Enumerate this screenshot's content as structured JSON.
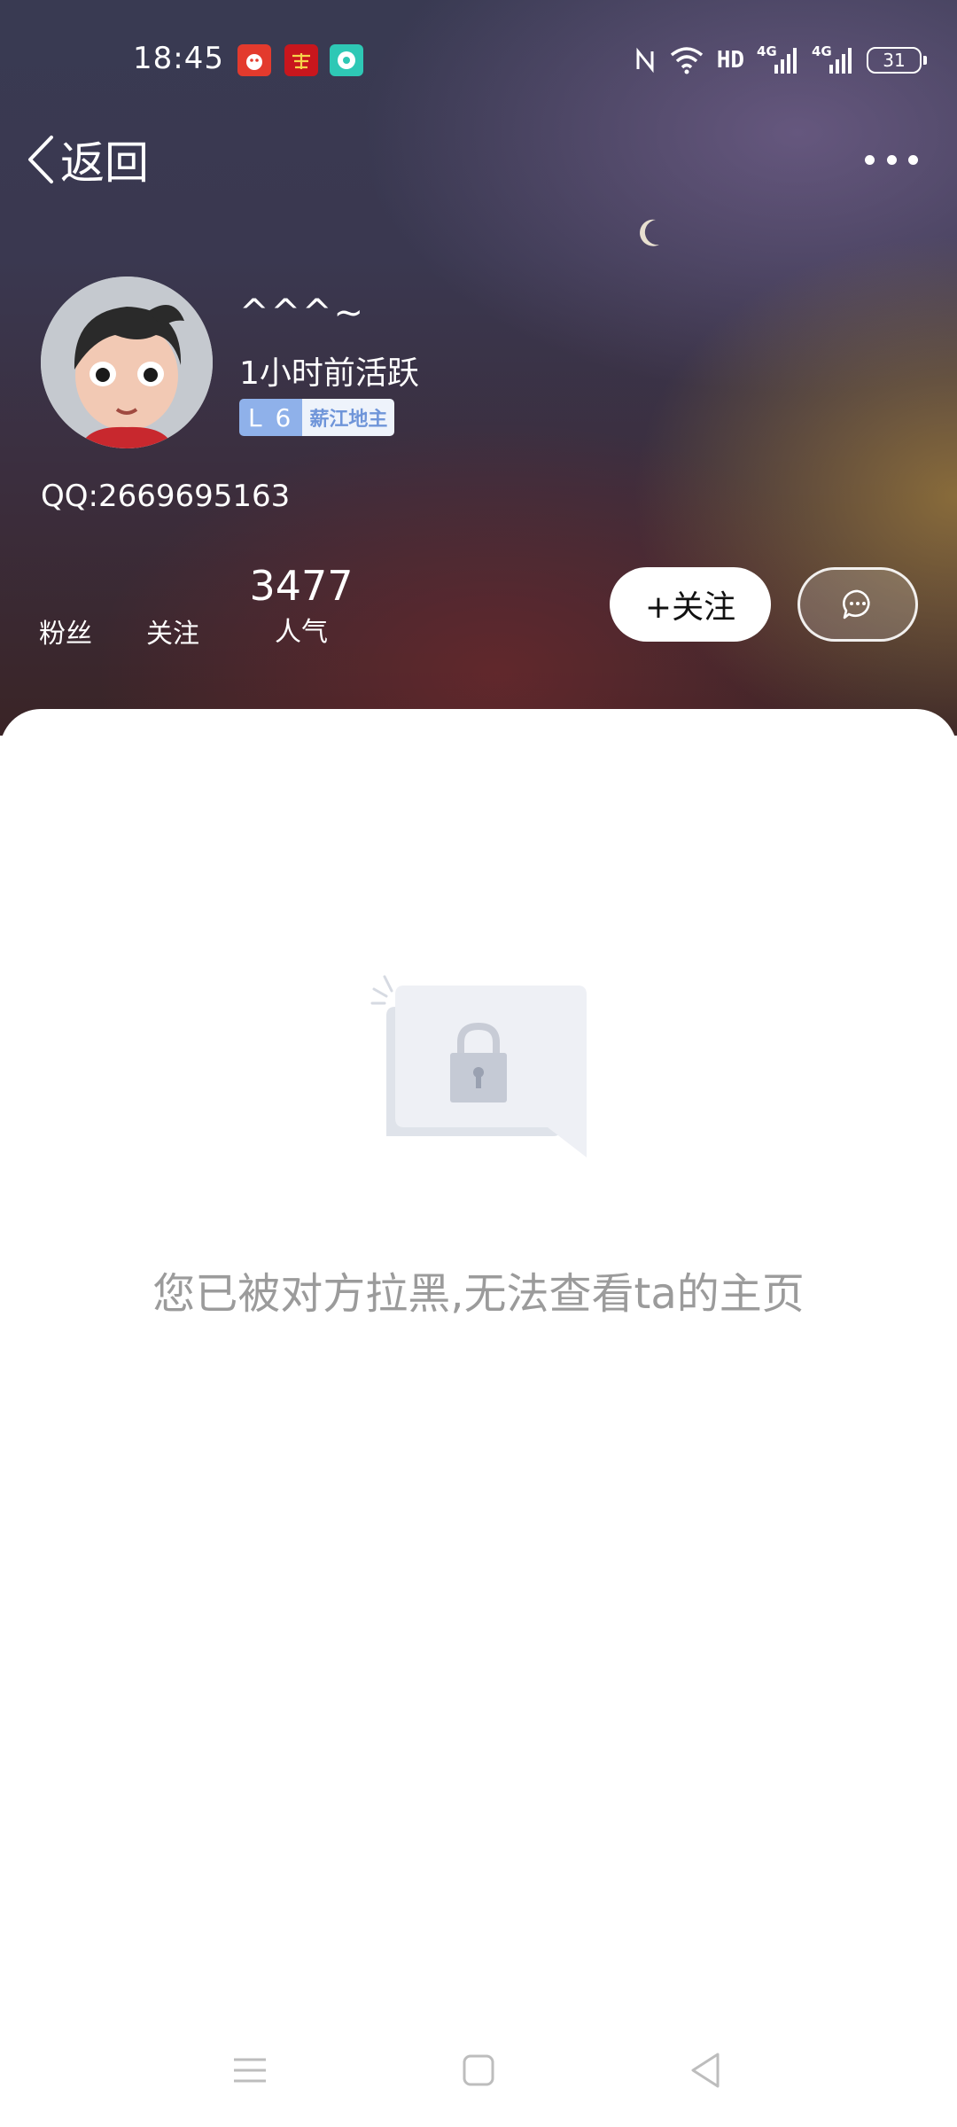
{
  "status_bar": {
    "time": "18:45",
    "hd_label": "HD",
    "signal_1_label": "4G",
    "signal_2_label": "4G",
    "battery": "31",
    "icons": [
      "notification-app-icon",
      "notification-study-icon",
      "notification-music-icon",
      "nfc-icon",
      "wifi-icon",
      "signal-icon",
      "battery-icon"
    ]
  },
  "nav": {
    "back_label": "返回",
    "more_icon": "more-icon"
  },
  "profile": {
    "username": "^^^~",
    "active_status": "1小时前活跃",
    "level": "L 6",
    "level_title": "薪江地主",
    "qq": "QQ:2669695163"
  },
  "stats": {
    "fans_label": "粉丝",
    "following_label": "关注",
    "popularity_value": "3477",
    "popularity_label": "人气"
  },
  "actions": {
    "follow_label": "+关注",
    "chat_icon": "chat-bubble-icon"
  },
  "content": {
    "blocked_message": "您已被对方拉黑,无法查看ta的主页",
    "illustration": "lock-icon"
  },
  "colors": {
    "level_accent": "#8fb1ea",
    "message_gray": "#9b9b9b"
  }
}
